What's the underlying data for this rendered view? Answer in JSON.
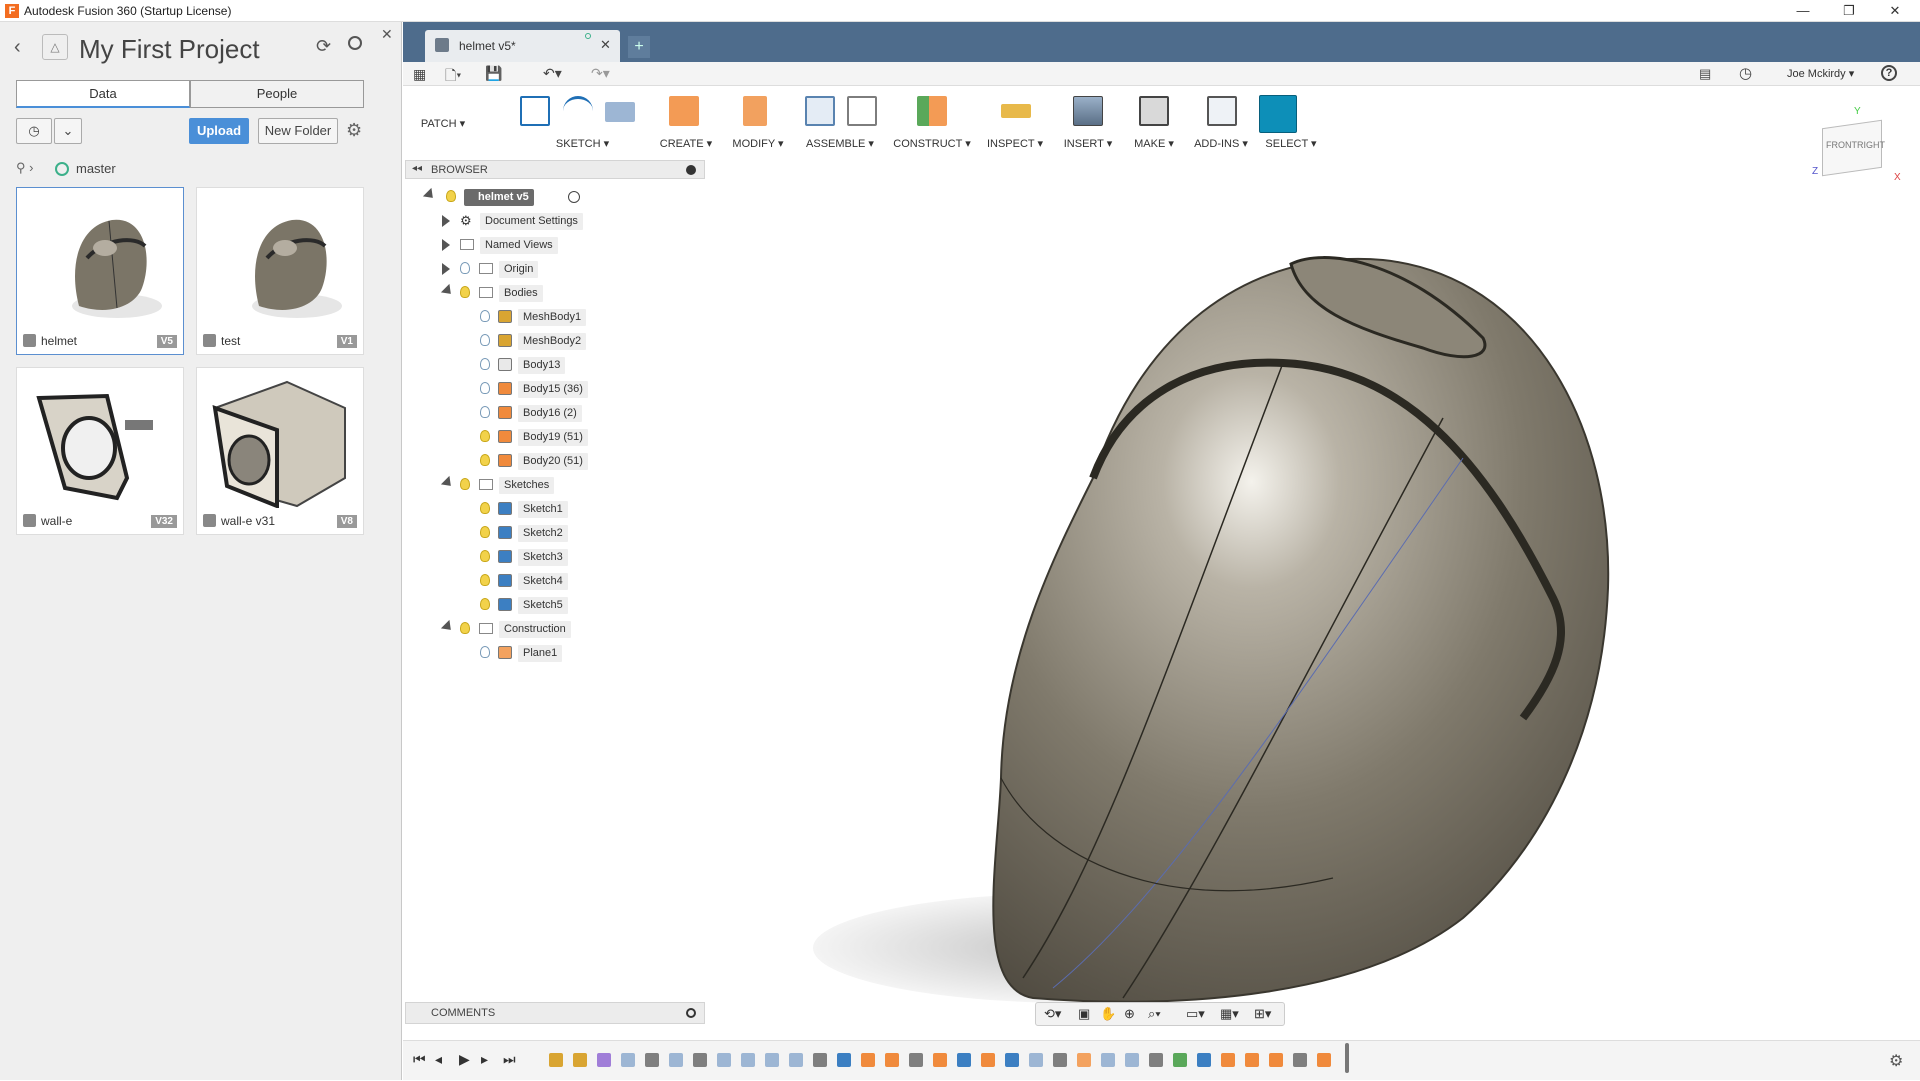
{
  "window": {
    "title": "Autodesk Fusion 360 (Startup License)",
    "logo": "F",
    "min": "—",
    "restore": "❐",
    "close": "✕"
  },
  "data_panel": {
    "project_title": "My First Project",
    "tabs": [
      "Data",
      "People"
    ],
    "upload_label": "Upload",
    "new_folder_label": "New Folder",
    "branch": "master",
    "cards": [
      {
        "name": "helmet",
        "version": "V5"
      },
      {
        "name": "test",
        "version": "V1"
      },
      {
        "name": "wall-e",
        "version": "V32"
      },
      {
        "name": "wall-e v31",
        "version": "V8"
      }
    ]
  },
  "doc_tab": {
    "label": "helmet v5*"
  },
  "toolbar": {
    "user": "Joe Mckirdy ▾",
    "help": "?"
  },
  "ribbon": {
    "workspace": "PATCH ▾",
    "groups": [
      "SKETCH ▾",
      "CREATE ▾",
      "MODIFY ▾",
      "ASSEMBLE ▾",
      "CONSTRUCT ▾",
      "INSPECT ▾",
      "INSERT ▾",
      "MAKE ▾",
      "ADD-INS ▾",
      "SELECT ▾"
    ]
  },
  "browser": {
    "header": "BROWSER",
    "root": "helmet v5",
    "items": [
      {
        "label": "Document Settings"
      },
      {
        "label": "Named Views"
      },
      {
        "label": "Origin"
      },
      {
        "label": "Bodies"
      },
      {
        "label": "MeshBody1"
      },
      {
        "label": "MeshBody2"
      },
      {
        "label": "Body13"
      },
      {
        "label": "Body15 (36)"
      },
      {
        "label": "Body16 (2)"
      },
      {
        "label": "Body19 (51)"
      },
      {
        "label": "Body20 (51)"
      },
      {
        "label": "Sketches"
      },
      {
        "label": "Sketch1"
      },
      {
        "label": "Sketch2"
      },
      {
        "label": "Sketch3"
      },
      {
        "label": "Sketch4"
      },
      {
        "label": "Sketch5"
      },
      {
        "label": "Construction"
      },
      {
        "label": "Plane1"
      }
    ]
  },
  "comments": {
    "label": "COMMENTS"
  },
  "viewcube": {
    "front": "FRONT",
    "right": "RIGHT",
    "x": "X",
    "y": "Y",
    "z": "Z"
  },
  "colors": {
    "accent": "#4a8fd8",
    "tabbar": "#4e6c8c",
    "select": "#0d8fb8"
  }
}
